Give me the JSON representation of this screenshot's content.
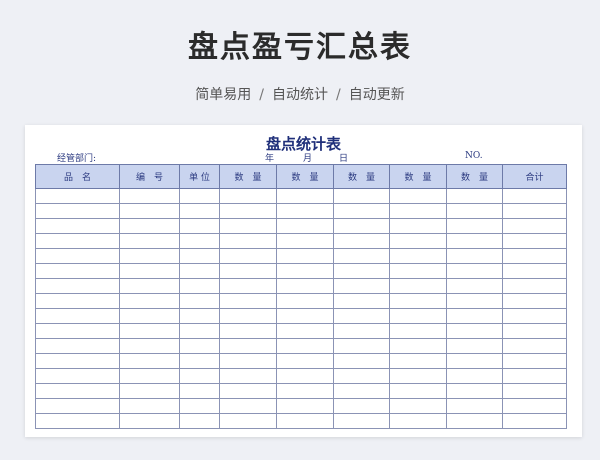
{
  "page": {
    "title": "盘点盈亏汇总表",
    "tags": [
      "简单易用",
      "自动统计",
      "自动更新"
    ],
    "separator": "/"
  },
  "sheet": {
    "title": "盘点统计表",
    "dept_label": "经管部门:",
    "year_label": "年",
    "month_label": "月",
    "day_label": "日",
    "no_label": "NO.",
    "columns": [
      "品　名",
      "编　号",
      "单 位",
      "数　量",
      "数　量",
      "数　量",
      "数　量",
      "数　量",
      "合计"
    ],
    "empty_rows": 16
  },
  "colors": {
    "header_bg": "#c9d4ef",
    "title_color": "#1f2f7a"
  }
}
